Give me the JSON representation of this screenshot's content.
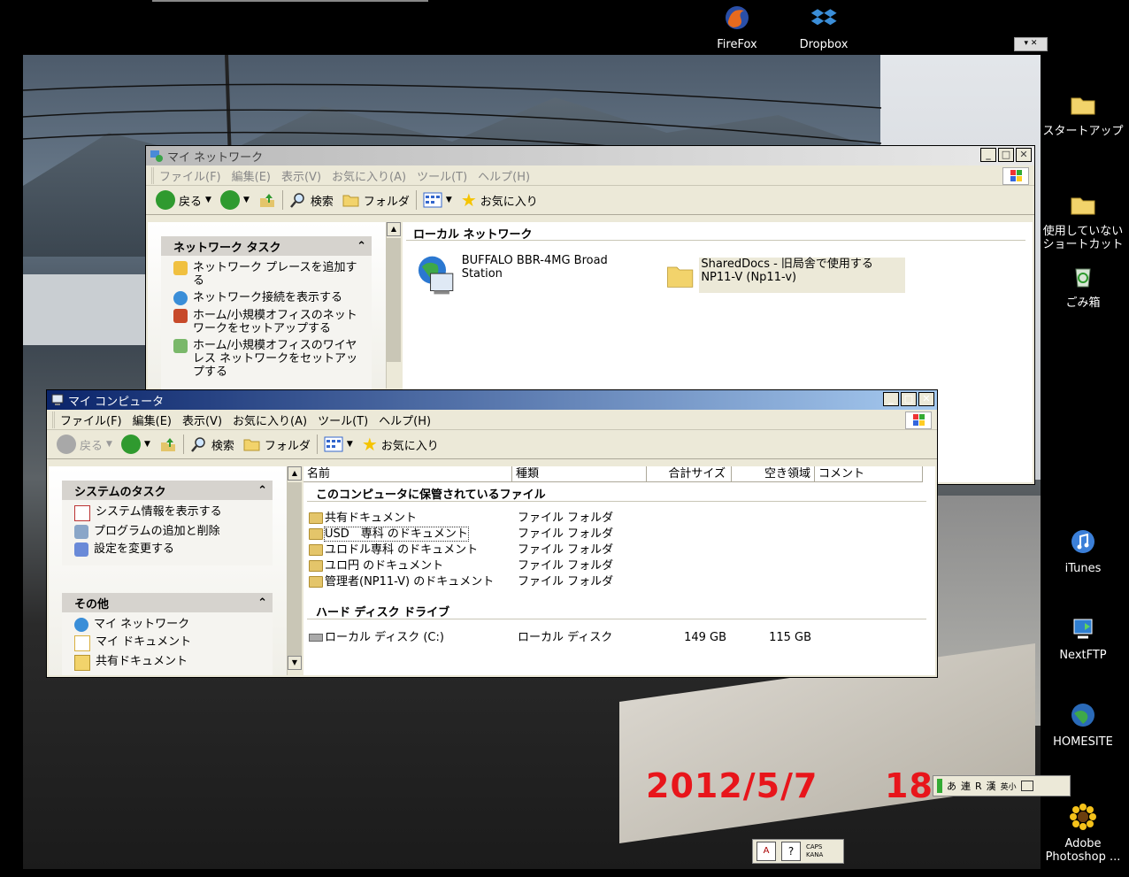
{
  "desktop": {
    "icons_top": [
      {
        "label": "FireFox",
        "icon": "firefox-icon"
      },
      {
        "label": "Dropbox",
        "icon": "dropbox-icon"
      }
    ],
    "icons_right": [
      {
        "label": "スタートアップ",
        "icon": "folder-icon"
      },
      {
        "label": "使用していない\nショートカット",
        "icon": "folder-icon"
      },
      {
        "label": "ごみ箱",
        "icon": "recycle-bin-icon"
      },
      {
        "label": "iTunes",
        "icon": "itunes-icon"
      },
      {
        "label": "NextFTP",
        "icon": "nextftp-icon"
      },
      {
        "label": "HOMESITE",
        "icon": "homesite-icon"
      },
      {
        "label": "Adobe\nPhotoshop ...",
        "icon": "photoshop-icon"
      }
    ],
    "wallpaper_date": "2012/5/7",
    "wallpaper_time": "18",
    "ime_bar": [
      "あ",
      "連",
      "R",
      "漢",
      "英小"
    ],
    "tray": {
      "caps": "CAPS",
      "kana": "KANA"
    }
  },
  "network_window": {
    "title": "マイ ネットワーク",
    "menu": [
      "ファイル(F)",
      "編集(E)",
      "表示(V)",
      "お気に入り(A)",
      "ツール(T)",
      "ヘルプ(H)"
    ],
    "toolbar": {
      "back": "戻る",
      "search": "検索",
      "folders": "フォルダ",
      "favorites": "お気に入り"
    },
    "task_title": "ネットワーク タスク",
    "tasks": [
      "ネットワーク プレースを追加する",
      "ネットワーク接続を表示する",
      "ホーム/小規模オフィスのネットワークをセットアップする",
      "ホーム/小規模オフィスのワイヤレス ネットワークをセットアップする"
    ],
    "group_title": "ローカル ネットワーク",
    "items": [
      {
        "name": "BUFFALO BBR-4MG Broad Station",
        "icon": "network-device-icon"
      },
      {
        "name": "SharedDocs - 旧局舎で使用する NP11-V (Np11-v)",
        "icon": "shared-folder-icon"
      }
    ]
  },
  "computer_window": {
    "title": "マイ コンピュータ",
    "menu": [
      "ファイル(F)",
      "編集(E)",
      "表示(V)",
      "お気に入り(A)",
      "ツール(T)",
      "ヘルプ(H)"
    ],
    "toolbar": {
      "back": "戻る",
      "search": "検索",
      "folders": "フォルダ",
      "favorites": "お気に入り"
    },
    "system_tasks_title": "システムのタスク",
    "system_tasks": [
      "システム情報を表示する",
      "プログラムの追加と削除",
      "設定を変更する"
    ],
    "other_title": "その他",
    "other_items": [
      "マイ ネットワーク",
      "マイ ドキュメント",
      "共有ドキュメント"
    ],
    "columns": [
      "名前",
      "種類",
      "合計サイズ",
      "空き領域",
      "コメント"
    ],
    "group_files": "このコンピュータに保管されているファイル",
    "files": [
      {
        "name": "共有ドキュメント",
        "type": "ファイル フォルダ"
      },
      {
        "name": "USD　専科 のドキュメント",
        "type": "ファイル フォルダ"
      },
      {
        "name": "ユロドル専科 のドキュメント",
        "type": "ファイル フォルダ"
      },
      {
        "name": "ユロ円 のドキュメント",
        "type": "ファイル フォルダ"
      },
      {
        "name": "管理者(NP11-V) のドキュメント",
        "type": "ファイル フォルダ"
      }
    ],
    "group_drives": "ハード ディスク ドライブ",
    "drives": [
      {
        "name": "ローカル ディスク (C:)",
        "type": "ローカル ディスク",
        "total": "149 GB",
        "free": "115 GB"
      }
    ]
  }
}
